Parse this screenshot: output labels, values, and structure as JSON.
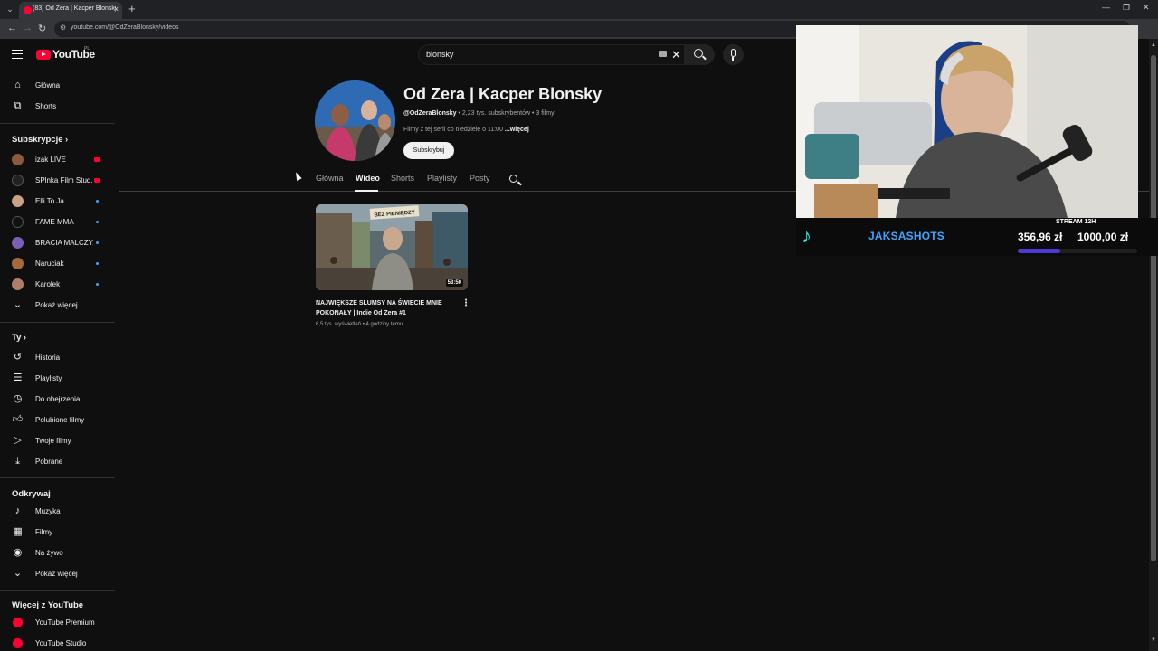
{
  "browser": {
    "tab_title": "(83) Od Zera | Kacper Blonsky",
    "close_glyph": "×",
    "new_tab_glyph": "+",
    "url": "youtube.com/@OdZeraBlonsky/videos"
  },
  "header": {
    "logo_text": "YouTube",
    "country_code": "PL",
    "search_query": "blonsky"
  },
  "sidebar": {
    "main": [
      {
        "label": "Główna",
        "icon": "home-icon"
      },
      {
        "label": "Shorts",
        "icon": "shorts-icon"
      }
    ],
    "subscriptions_heading": "Subskrypcje",
    "subscriptions": [
      {
        "label": "izak LIVE",
        "status": "live",
        "color": "#8a5a3c"
      },
      {
        "label": "SPlnka Film Stud...",
        "status": "live",
        "color": "#222222"
      },
      {
        "label": "Elli To Ja",
        "status": "new",
        "color": "#c9a184"
      },
      {
        "label": "FAME MMA",
        "status": "new",
        "color": "#111111"
      },
      {
        "label": "BRACIA MALCZY...",
        "status": "new",
        "color": "#7b5fb5"
      },
      {
        "label": "Naruciak",
        "status": "new",
        "color": "#a66a3a"
      },
      {
        "label": "Karolek",
        "status": "new",
        "color": "#b07d6a"
      }
    ],
    "show_more_1": "Pokaż więcej",
    "you_heading": "Ty",
    "you": [
      {
        "label": "Historia",
        "icon": "history-icon"
      },
      {
        "label": "Playlisty",
        "icon": "playlists-icon"
      },
      {
        "label": "Do obejrzenia",
        "icon": "watch-later-icon"
      },
      {
        "label": "Polubione filmy",
        "icon": "liked-icon"
      },
      {
        "label": "Twoje filmy",
        "icon": "your-videos-icon"
      },
      {
        "label": "Pobrane",
        "icon": "download-icon"
      }
    ],
    "explore_heading": "Odkrywaj",
    "explore": [
      {
        "label": "Muzyka",
        "icon": "music-icon"
      },
      {
        "label": "Filmy",
        "icon": "movies-icon"
      },
      {
        "label": "Na żywo",
        "icon": "live-icon"
      }
    ],
    "show_more_2": "Pokaż więcej",
    "more_heading": "Więcej z YouTube",
    "more": [
      {
        "label": "YouTube Premium",
        "icon": "youtube-premium-icon"
      },
      {
        "label": "YouTube Studio",
        "icon": "youtube-studio-icon"
      }
    ]
  },
  "channel": {
    "name": "Od Zera | Kacper Blonsky",
    "handle": "@OdZeraBlonsky",
    "stats": " • 2,23 tys. subskrybentów • 3 filmy",
    "description": "Filmy z tej serii co niedzielę o 11:00 ",
    "more_link": "...więcej",
    "subscribe_label": "Subskrybuj",
    "tabs": [
      "Główna",
      "Wideo",
      "Shorts",
      "Playlisty",
      "Posty"
    ],
    "active_tab": "Wideo"
  },
  "videos": [
    {
      "title": "NAJWIĘKSZE SLUMSY NA ŚWIECIE MNIE POKONAŁY | Indie Od Zera #1",
      "duration": "53:50",
      "views": "6,5 tys. wyświetleń",
      "age": "4 godziny temu",
      "sign_text": "BEZ PIENIĘDZY"
    }
  ],
  "overlay": {
    "handle": "JAKSASHOTS",
    "stream_label": "STREAM 12H",
    "current_amount": "356,96 zł",
    "goal_amount": "1000,00 zł",
    "progress_fraction": 0.357,
    "progress_color": "#4b3bd6",
    "tiktok_icon": "tiktok-icon"
  }
}
